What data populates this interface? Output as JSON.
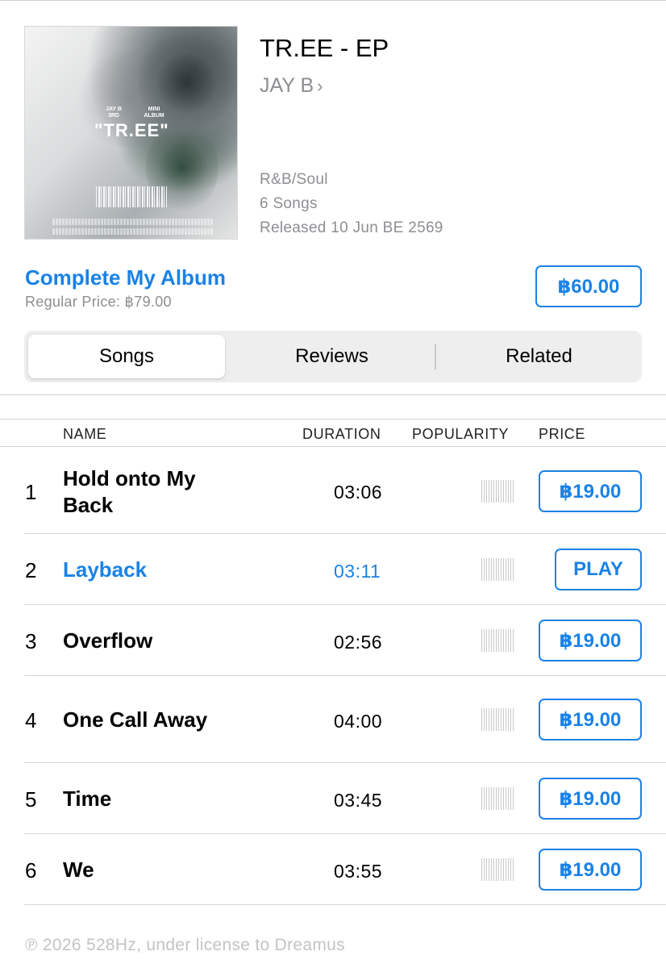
{
  "album": {
    "title": "TR.EE - EP",
    "artist": "JAY B",
    "artist_chevron": "›",
    "genre": "R&B/Soul",
    "song_count": "6 Songs",
    "released": "Released 10 Jun BE 2569",
    "cover": {
      "artist_line": "JAY B\n3RD",
      "type_line": "MINI\nALBUM",
      "title": "\"TR.EE\""
    }
  },
  "purchase": {
    "complete_label": "Complete My Album",
    "regular_price": "Regular Price: ฿79.00",
    "price": "฿60.00"
  },
  "tabs": [
    {
      "label": "Songs",
      "selected": true
    },
    {
      "label": "Reviews",
      "selected": false
    },
    {
      "label": "Related",
      "selected": false
    }
  ],
  "table": {
    "headers": {
      "name": "NAME",
      "duration": "DURATION",
      "popularity": "POPULARITY",
      "price": "PRICE"
    },
    "rows": [
      {
        "num": "1",
        "name": "Hold onto My Back",
        "duration": "03:06",
        "price": "฿19.00",
        "highlighted": false
      },
      {
        "num": "2",
        "name": "Layback",
        "duration": "03:11",
        "price": "PLAY",
        "highlighted": true
      },
      {
        "num": "3",
        "name": "Overflow",
        "duration": "02:56",
        "price": "฿19.00",
        "highlighted": false
      },
      {
        "num": "4",
        "name": "One Call Away",
        "duration": "04:00",
        "price": "฿19.00",
        "highlighted": false
      },
      {
        "num": "5",
        "name": "Time",
        "duration": "03:45",
        "price": "฿19.00",
        "highlighted": false
      },
      {
        "num": "6",
        "name": "We",
        "duration": "03:55",
        "price": "฿19.00",
        "highlighted": false
      }
    ]
  },
  "footer": "℗ 2026 528Hz, under license to Dreamus",
  "colors": {
    "accent": "#1a82e6",
    "secondary_text": "#8e8e93"
  }
}
